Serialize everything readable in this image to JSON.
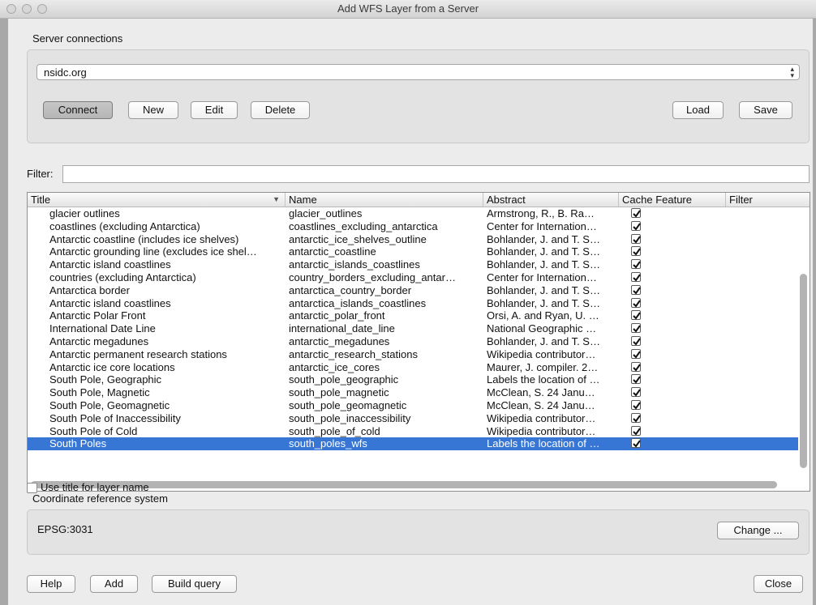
{
  "window": {
    "title": "Add WFS Layer from a Server"
  },
  "server": {
    "group_label": "Server connections",
    "selected_connection": "nsidc.org",
    "buttons": {
      "connect": "Connect",
      "new": "New",
      "edit": "Edit",
      "delete": "Delete",
      "load": "Load",
      "save": "Save"
    }
  },
  "filter": {
    "label": "Filter:",
    "value": ""
  },
  "table": {
    "columns": [
      "Title",
      "Name",
      "Abstract",
      "Cache Feature",
      "Filter"
    ],
    "rows": [
      {
        "title": "glacier outlines",
        "name": "glacier_outlines",
        "abstract": "Armstrong, R., B. Ra…",
        "cache": true
      },
      {
        "title": "coastlines (excluding Antarctica)",
        "name": "coastlines_excluding_antarctica",
        "abstract": "Center for Internation…",
        "cache": true
      },
      {
        "title": "Antarctic coastline (includes ice shelves)",
        "name": "antarctic_ice_shelves_outline",
        "abstract": "Bohlander, J. and T. S…",
        "cache": true
      },
      {
        "title": "Antarctic grounding line (excludes ice shel…",
        "name": "antarctic_coastline",
        "abstract": "Bohlander, J. and T. S…",
        "cache": true
      },
      {
        "title": "Antarctic island coastlines",
        "name": "antarctic_islands_coastlines",
        "abstract": "Bohlander, J. and T. S…",
        "cache": true
      },
      {
        "title": "countries (excluding Antarctica)",
        "name": "country_borders_excluding_antar…",
        "abstract": "Center for Internation…",
        "cache": true
      },
      {
        "title": "Antarctica border",
        "name": "antarctica_country_border",
        "abstract": "Bohlander, J. and T. S…",
        "cache": true
      },
      {
        "title": "Antarctic island coastlines",
        "name": "antarctica_islands_coastlines",
        "abstract": "Bohlander, J. and T. S…",
        "cache": true
      },
      {
        "title": "Antarctic Polar Front",
        "name": "antarctic_polar_front",
        "abstract": "Orsi, A. and Ryan, U. …",
        "cache": true
      },
      {
        "title": "International Date Line",
        "name": "international_date_line",
        "abstract": "National Geographic …",
        "cache": true
      },
      {
        "title": "Antarctic megadunes",
        "name": "antarctic_megadunes",
        "abstract": "Bohlander, J. and T. S…",
        "cache": true
      },
      {
        "title": "Antarctic permanent research stations",
        "name": "antarctic_research_stations",
        "abstract": "Wikipedia contributor…",
        "cache": true
      },
      {
        "title": "Antarctic ice core locations",
        "name": "antarctic_ice_cores",
        "abstract": "Maurer, J. compiler. 2…",
        "cache": true
      },
      {
        "title": "South Pole, Geographic",
        "name": "south_pole_geographic",
        "abstract": "Labels the location of …",
        "cache": true
      },
      {
        "title": "South Pole, Magnetic",
        "name": "south_pole_magnetic",
        "abstract": "McClean, S. 24 Janu…",
        "cache": true
      },
      {
        "title": "South Pole, Geomagnetic",
        "name": "south_pole_geomagnetic",
        "abstract": "McClean, S. 24 Janu…",
        "cache": true
      },
      {
        "title": "South Pole of Inaccessibility",
        "name": "south_pole_inaccessibility",
        "abstract": "Wikipedia contributor…",
        "cache": true
      },
      {
        "title": "South Pole of Cold",
        "name": "south_pole_of_cold",
        "abstract": "Wikipedia contributor…",
        "cache": true
      },
      {
        "title": "South Poles",
        "name": "south_poles_wfs",
        "abstract": "Labels the location of …",
        "cache": true,
        "selected": true
      }
    ]
  },
  "use_title": {
    "label": "Use title for layer name",
    "checked": false
  },
  "crs": {
    "group_label": "Coordinate reference system",
    "value": "EPSG:3031",
    "change_label": "Change ..."
  },
  "footer": {
    "help": "Help",
    "add": "Add",
    "build_query": "Build query",
    "close": "Close"
  }
}
